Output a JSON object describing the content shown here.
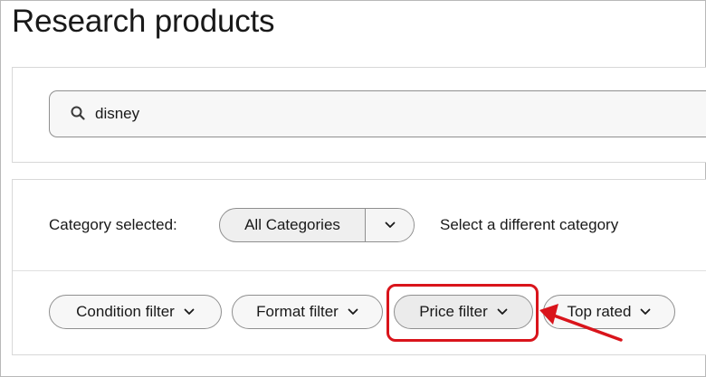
{
  "page": {
    "title": "Research products"
  },
  "search": {
    "value": "disney",
    "icon": "search-icon"
  },
  "category": {
    "label": "Category selected:",
    "selected": "All Categories",
    "hint": "Select a different category"
  },
  "filters": [
    {
      "label": "Condition filter"
    },
    {
      "label": "Format filter"
    },
    {
      "label": "Price filter"
    },
    {
      "label": "Top rated"
    }
  ],
  "annotation": {
    "highlighted_filter": "Price filter",
    "color": "#d9141b"
  }
}
